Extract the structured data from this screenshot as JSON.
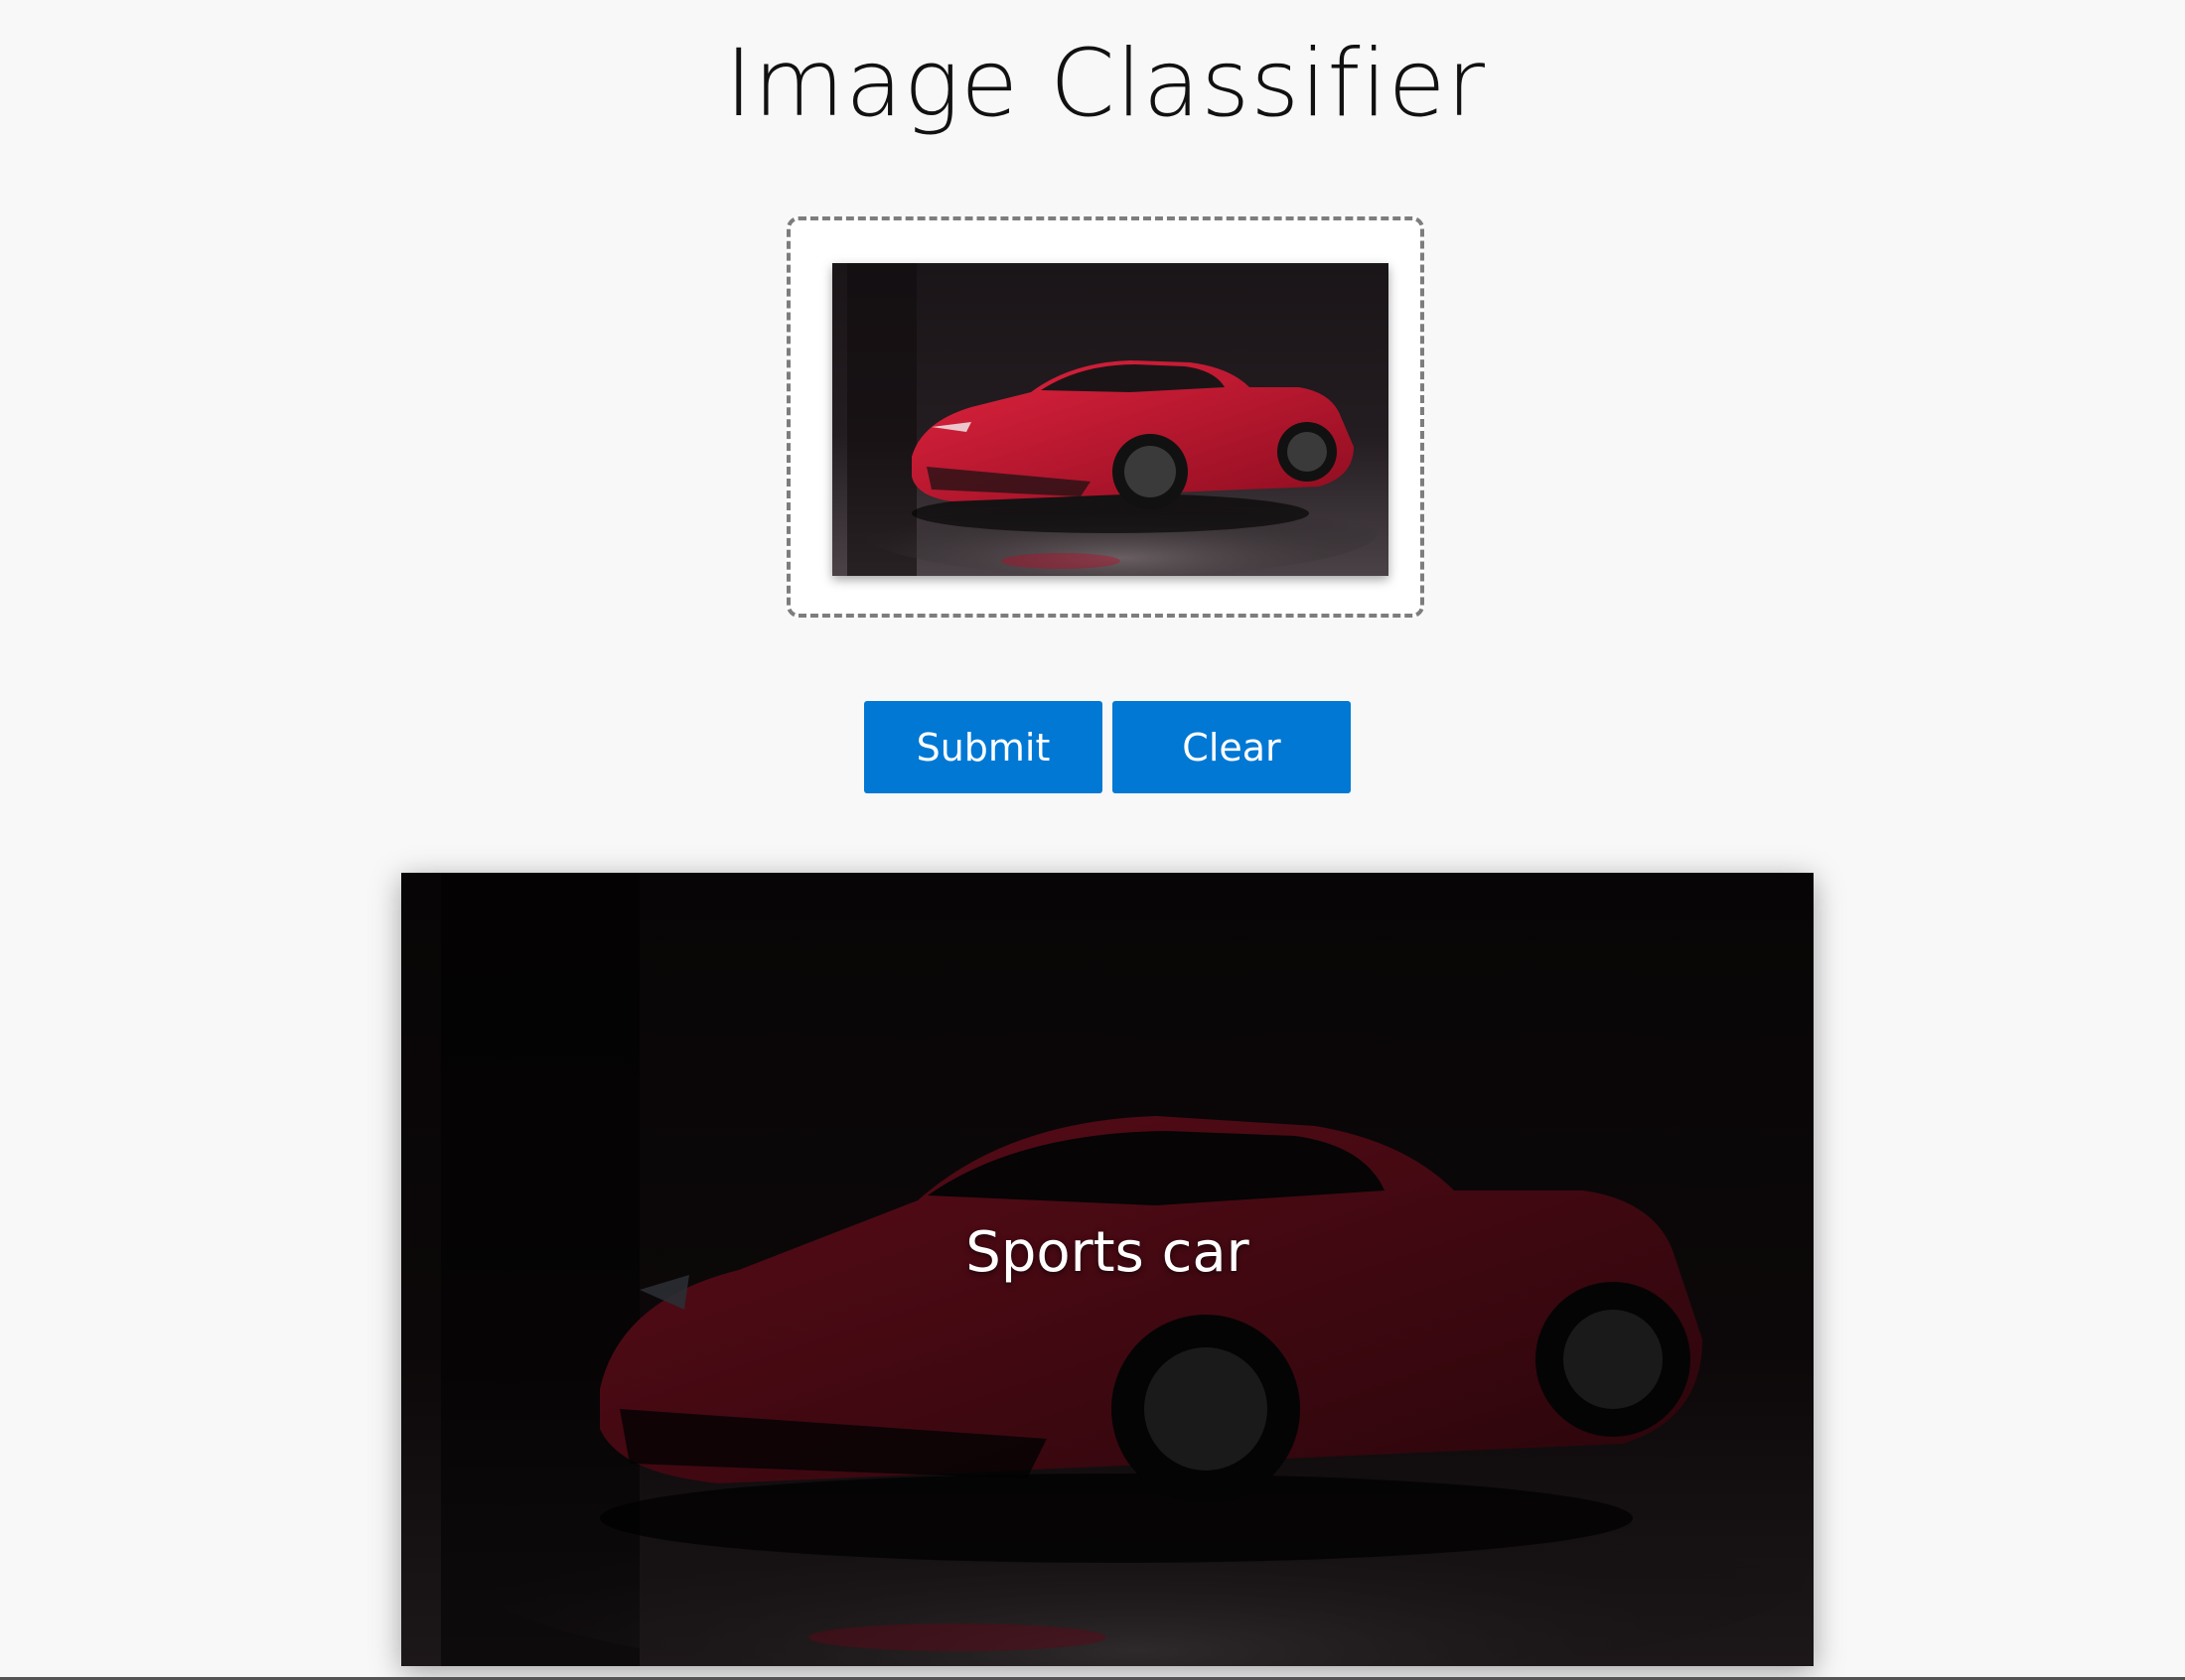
{
  "app": {
    "title": "Image Classifier"
  },
  "upload": {
    "preview_alt": "Sports car image preview"
  },
  "actions": {
    "submit_label": "Submit",
    "clear_label": "Clear"
  },
  "result": {
    "label": "Sports car"
  },
  "colors": {
    "background": "#f8f8f8",
    "accent": "#0078d4",
    "dropzone_border": "#7d7d7d",
    "car_red": "#c8102e"
  },
  "icons": {
    "preview": "car-photo-icon"
  }
}
